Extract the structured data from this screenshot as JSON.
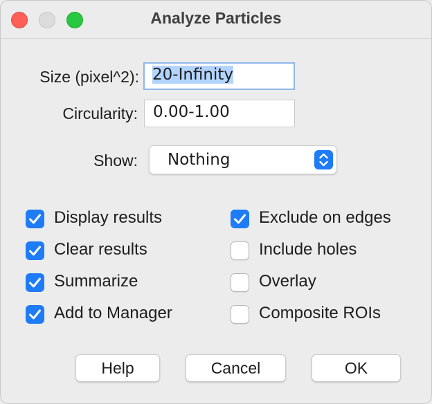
{
  "window": {
    "title": "Analyze Particles"
  },
  "fields": {
    "size_label": "Size (pixel^2):",
    "size_value": "20-Infinity",
    "circularity_label": "Circularity:",
    "circularity_value": "0.00-1.00"
  },
  "show": {
    "label": "Show:",
    "value": "Nothing"
  },
  "options_left": [
    {
      "label": "Display results",
      "checked": true
    },
    {
      "label": "Clear results",
      "checked": true
    },
    {
      "label": "Summarize",
      "checked": true
    },
    {
      "label": "Add to Manager",
      "checked": true
    }
  ],
  "options_right": [
    {
      "label": "Exclude on edges",
      "checked": true
    },
    {
      "label": "Include holes",
      "checked": false
    },
    {
      "label": "Overlay",
      "checked": false
    },
    {
      "label": "Composite ROIs",
      "checked": false
    }
  ],
  "buttons": {
    "help": "Help",
    "cancel": "Cancel",
    "ok": "OK"
  },
  "colors": {
    "accent": "#1e7cf6",
    "selection": "#b3d4fe",
    "close": "#fe5f57",
    "maximize": "#28c840"
  }
}
